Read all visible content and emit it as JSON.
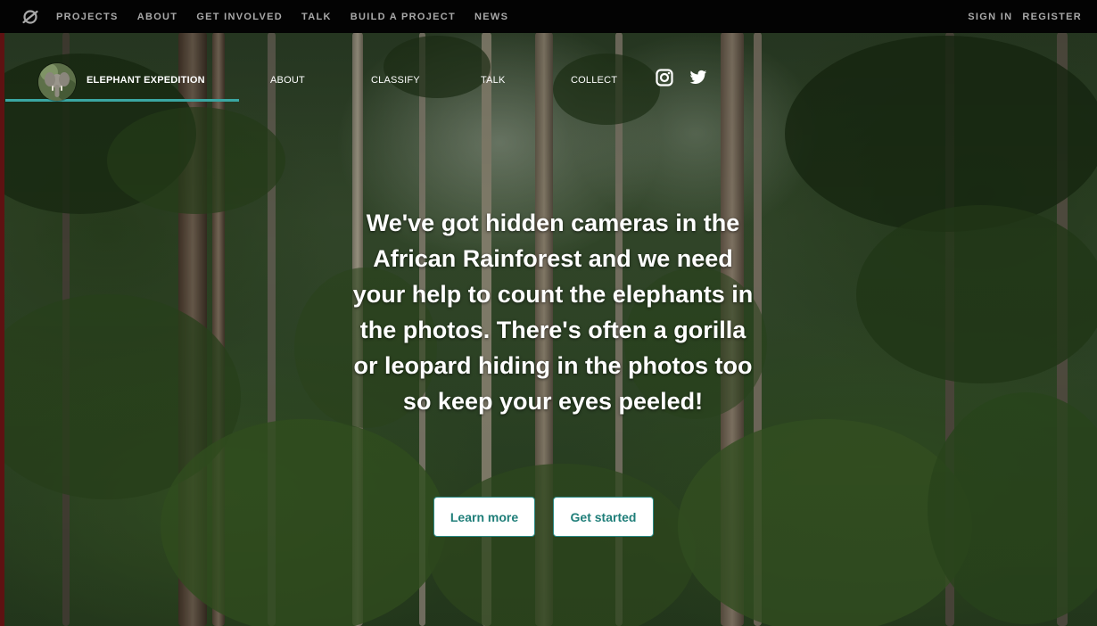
{
  "top_bar": {
    "nav": [
      "PROJECTS",
      "ABOUT",
      "GET INVOLVED",
      "TALK",
      "BUILD A PROJECT",
      "NEWS"
    ],
    "sign_in": "SIGN IN",
    "register": "REGISTER"
  },
  "project": {
    "title": "ELEPHANT EXPEDITION",
    "nav": [
      "ABOUT",
      "CLASSIFY",
      "TALK",
      "COLLECT"
    ],
    "social_icons": [
      "instagram-icon",
      "twitter-icon"
    ]
  },
  "hero": {
    "text": "We've got hidden cameras in the African Rainforest and we need your help to count the elephants in the photos. There's often a gorilla or leopard hiding in the photos too so keep your eyes peeled!",
    "learn_more": "Learn more",
    "get_started": "Get started"
  },
  "colors": {
    "accent": "#3aa7a3",
    "button_text": "#1f7e79",
    "top_bar_bg": "#030303"
  }
}
